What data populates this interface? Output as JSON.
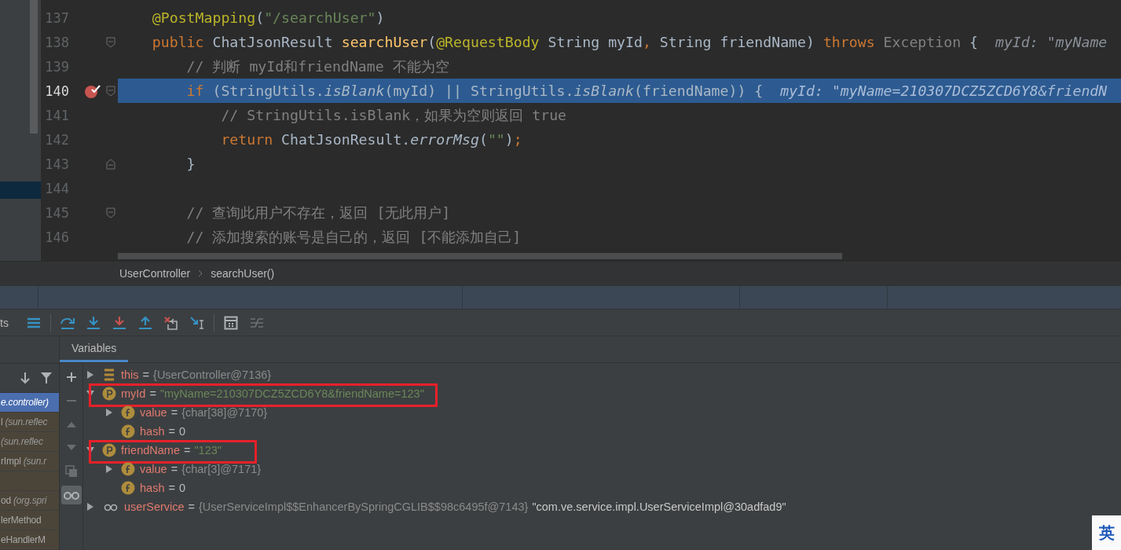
{
  "editor": {
    "lines": [
      {
        "number": "137",
        "tokens": [
          {
            "t": "    @PostMapping",
            "kind": "ann"
          },
          {
            "t": "(",
            "kind": "plain"
          },
          {
            "t": "\"/searchUser\"",
            "kind": "str"
          },
          {
            "t": ")",
            "kind": "plain"
          }
        ]
      },
      {
        "number": "138",
        "fold_start": true,
        "tokens": [
          {
            "t": "    public",
            "kind": "kw"
          },
          {
            "t": " ChatJsonResult ",
            "kind": "plain"
          },
          {
            "t": "searchUser",
            "kind": "method"
          },
          {
            "t": "(",
            "kind": "plain"
          },
          {
            "t": "@RequestBody",
            "kind": "ann"
          },
          {
            "t": " String myId",
            "kind": "plain"
          },
          {
            "t": ",",
            "kind": "kw"
          },
          {
            "t": " String friendName) ",
            "kind": "plain"
          },
          {
            "t": "throws",
            "kind": "kw"
          },
          {
            "t": " Exception",
            "kind": "dim"
          },
          {
            "t": " {",
            "kind": "plain"
          },
          {
            "t": "  myId: \"myName",
            "kind": "hint"
          }
        ]
      },
      {
        "number": "139",
        "tokens": [
          {
            "t": "        // 判断 myId和friendName 不能为空",
            "kind": "cmt"
          }
        ]
      },
      {
        "number": "140",
        "fold_start": true,
        "current": true,
        "breakpoint": true,
        "tokens": [
          {
            "t": "        if",
            "kind": "kw"
          },
          {
            "t": " (StringUtils.",
            "kind": "plain"
          },
          {
            "t": "isBlank",
            "kind": "ital"
          },
          {
            "t": "(myId) || StringUtils.",
            "kind": "plain"
          },
          {
            "t": "isBlank",
            "kind": "ital"
          },
          {
            "t": "(friendName)) {",
            "kind": "plain"
          },
          {
            "t": "  myId: \"myName=210307DCZ5ZCD6Y8&friendN",
            "kind": "hint"
          }
        ]
      },
      {
        "number": "141",
        "tokens": [
          {
            "t": "            // StringUtils.isBlank，如果为空则返回 true",
            "kind": "cmt"
          }
        ]
      },
      {
        "number": "142",
        "tokens": [
          {
            "t": "            return",
            "kind": "kw"
          },
          {
            "t": " ChatJsonResult.",
            "kind": "plain"
          },
          {
            "t": "errorMsg",
            "kind": "ital"
          },
          {
            "t": "(",
            "kind": "plain"
          },
          {
            "t": "\"\"",
            "kind": "str"
          },
          {
            "t": ")",
            "kind": "plain"
          },
          {
            "t": ";",
            "kind": "kw"
          }
        ]
      },
      {
        "number": "143",
        "fold_end": true,
        "tokens": [
          {
            "t": "        }",
            "kind": "plain"
          }
        ]
      },
      {
        "number": "144"
      },
      {
        "number": "145",
        "fold_start": true,
        "tokens": [
          {
            "t": "        // 查询此用户不存在，返回 [无此用户]",
            "kind": "cmt"
          }
        ]
      },
      {
        "number": "146",
        "tokens": [
          {
            "t": "        // 添加搜索的账号是自己的，返回 [不能添加自己]",
            "kind": "cmt"
          }
        ]
      }
    ]
  },
  "breadcrumbs": [
    "UserController",
    "searchUser()"
  ],
  "debug_toolbar": {
    "cut_label": "ts",
    "buttons": [
      {
        "kind": "layout",
        "disabled": false
      },
      {
        "kind": "stepover",
        "disabled": false
      },
      {
        "kind": "stepinto",
        "disabled": false
      },
      {
        "kind": "forceinto",
        "disabled": false
      },
      {
        "kind": "stepout",
        "disabled": false
      },
      {
        "kind": "dropframe",
        "disabled": false
      },
      {
        "kind": "runtocursor",
        "disabled": false
      },
      {
        "kind": "evaluate",
        "disabled": false
      },
      {
        "kind": "trace",
        "disabled": true
      }
    ]
  },
  "frames": [
    {
      "location": "e.controller)",
      "selected": true
    },
    {
      "name": "l",
      "location": "(sun.reflec",
      "selected": false
    },
    {
      "location": "(sun.reflec",
      "selected": false
    },
    {
      "name": "rImpl",
      "location": "(sun.r",
      "selected": false
    },
    {
      "selected": false
    },
    {
      "name": "od",
      "location": "(org.spri",
      "selected": false
    },
    {
      "name": "lerMethod",
      "selected": false
    },
    {
      "name": "eHandlerM",
      "selected": false
    }
  ],
  "variables_tab": {
    "label": "Variables",
    "selected": true
  },
  "side_toolbar": [
    {
      "kind": "add",
      "disabled": false,
      "selected": false
    },
    {
      "kind": "remove",
      "disabled": true,
      "selected": false
    },
    {
      "kind": "up",
      "disabled": true,
      "selected": false
    },
    {
      "kind": "down",
      "disabled": true,
      "selected": false
    },
    {
      "kind": "copy",
      "disabled": true,
      "selected": false
    },
    {
      "kind": "watches",
      "disabled": false,
      "selected": true
    }
  ],
  "variables": [
    {
      "kind": "object",
      "name": "this",
      "operator": "=",
      "value": {
        "kind": "ref",
        "text": "{UserController@7136}"
      },
      "expanded": false
    },
    {
      "kind": "param",
      "name": "myId",
      "operator": "=",
      "value": {
        "kind": "string",
        "text": "\"myName=210307DCZ5ZCD6Y8&friendName=123\""
      },
      "expanded": true,
      "highlighted": true,
      "children": [
        {
          "kind": "field",
          "name": "value",
          "operator": "=",
          "value": {
            "kind": "ref",
            "text": "{char[38]@7170}"
          },
          "expanded": false
        },
        {
          "kind": "field",
          "name": "hash",
          "operator": "=",
          "value": {
            "kind": "number",
            "text": "0"
          }
        }
      ]
    },
    {
      "kind": "param",
      "name": "friendName",
      "operator": "=",
      "value": {
        "kind": "string",
        "text": "\"123\""
      },
      "expanded": true,
      "highlighted": true,
      "children": [
        {
          "kind": "field",
          "name": "value",
          "operator": "=",
          "value": {
            "kind": "ref",
            "text": "{char[3]@7171}"
          },
          "expanded": false
        },
        {
          "kind": "field",
          "name": "hash",
          "operator": "=",
          "value": {
            "kind": "number",
            "text": "0"
          }
        }
      ]
    },
    {
      "kind": "watch",
      "name": "userService",
      "operator": "=",
      "value": {
        "kind": "ref",
        "text": "{UserServiceImpl$$EnhancerBySpringCGLIB$$98c6495f@7143}"
      },
      "expanded": false,
      "to_string": "\"com.ve.service.impl.UserServiceImpl@30adfad9\""
    }
  ],
  "ime_indicator": "英"
}
